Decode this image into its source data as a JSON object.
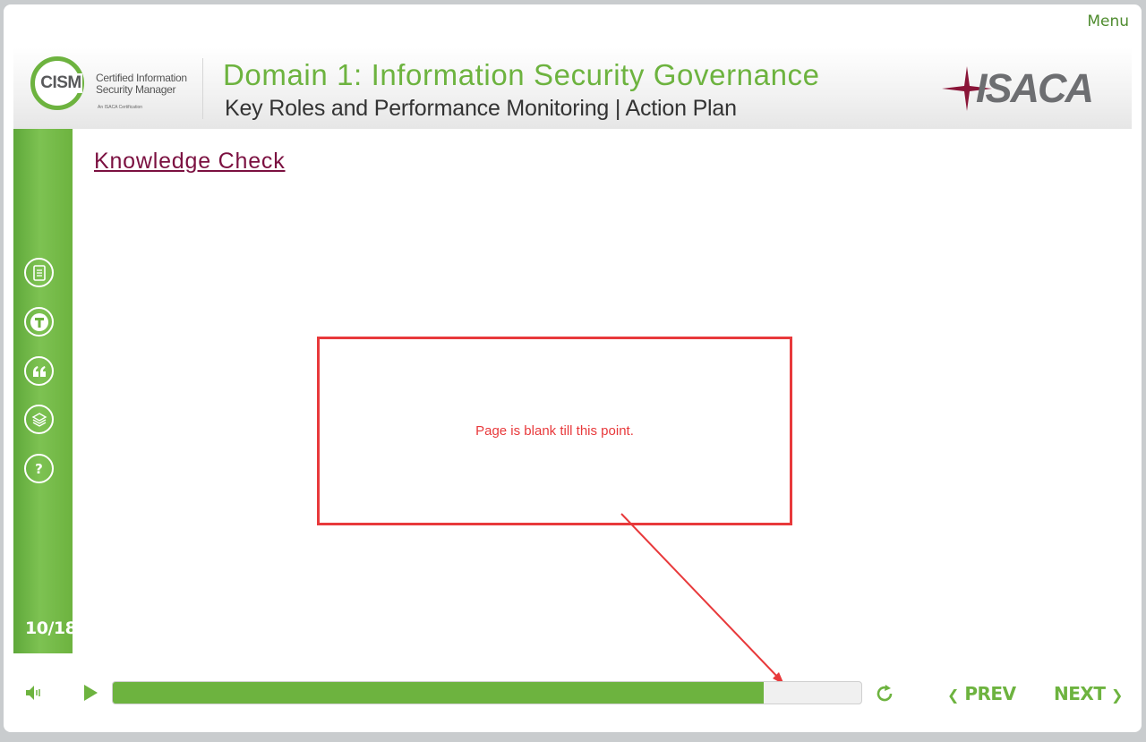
{
  "header": {
    "menu_label": "Menu",
    "logo_text": "CISM",
    "logo_line1": "Certified Information",
    "logo_line2": "Security Manager",
    "logo_sub": "An ISACA Certification",
    "domain_title": "Domain 1: Information Security Governance",
    "sub_title": "Key Roles and Performance Monitoring | Action Plan",
    "brand_logo": "ISACA"
  },
  "sidebar": {
    "icons": [
      {
        "name": "transcript-icon"
      },
      {
        "name": "text-icon"
      },
      {
        "name": "quote-icon"
      },
      {
        "name": "layers-icon"
      },
      {
        "name": "help-icon"
      }
    ],
    "page_counter": "10/18"
  },
  "content": {
    "heading": "Knowledge Check",
    "annotation_text": "Page is blank till this point."
  },
  "footer": {
    "progress_fraction": 0.87,
    "prev_label": "PREV",
    "next_label": "NEXT"
  },
  "colors": {
    "accent_green": "#6db33f",
    "heading_maroon": "#7b1040",
    "annotation_red": "#e8393b"
  }
}
